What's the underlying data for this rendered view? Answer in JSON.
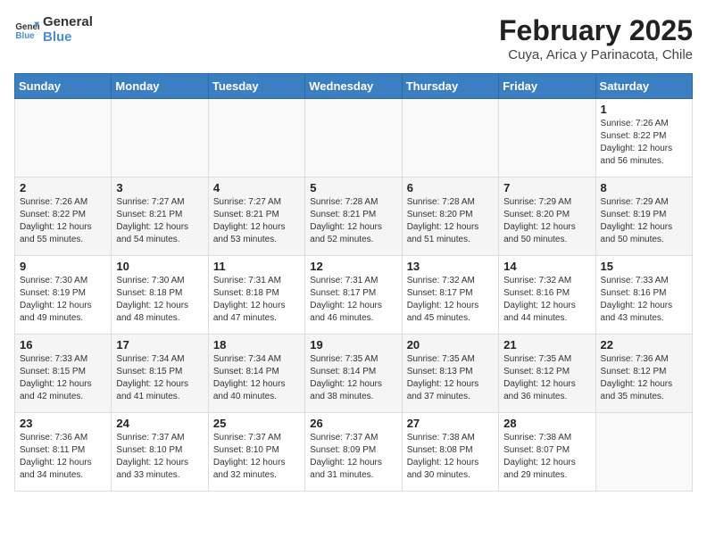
{
  "header": {
    "logo_line1": "General",
    "logo_line2": "Blue",
    "title": "February 2025",
    "subtitle": "Cuya, Arica y Parinacota, Chile"
  },
  "calendar": {
    "days_of_week": [
      "Sunday",
      "Monday",
      "Tuesday",
      "Wednesday",
      "Thursday",
      "Friday",
      "Saturday"
    ],
    "weeks": [
      {
        "shade": false,
        "days": [
          {
            "num": "",
            "info": ""
          },
          {
            "num": "",
            "info": ""
          },
          {
            "num": "",
            "info": ""
          },
          {
            "num": "",
            "info": ""
          },
          {
            "num": "",
            "info": ""
          },
          {
            "num": "",
            "info": ""
          },
          {
            "num": "1",
            "info": "Sunrise: 7:26 AM\nSunset: 8:22 PM\nDaylight: 12 hours and 56 minutes."
          }
        ]
      },
      {
        "shade": true,
        "days": [
          {
            "num": "2",
            "info": "Sunrise: 7:26 AM\nSunset: 8:22 PM\nDaylight: 12 hours and 55 minutes."
          },
          {
            "num": "3",
            "info": "Sunrise: 7:27 AM\nSunset: 8:21 PM\nDaylight: 12 hours and 54 minutes."
          },
          {
            "num": "4",
            "info": "Sunrise: 7:27 AM\nSunset: 8:21 PM\nDaylight: 12 hours and 53 minutes."
          },
          {
            "num": "5",
            "info": "Sunrise: 7:28 AM\nSunset: 8:21 PM\nDaylight: 12 hours and 52 minutes."
          },
          {
            "num": "6",
            "info": "Sunrise: 7:28 AM\nSunset: 8:20 PM\nDaylight: 12 hours and 51 minutes."
          },
          {
            "num": "7",
            "info": "Sunrise: 7:29 AM\nSunset: 8:20 PM\nDaylight: 12 hours and 50 minutes."
          },
          {
            "num": "8",
            "info": "Sunrise: 7:29 AM\nSunset: 8:19 PM\nDaylight: 12 hours and 50 minutes."
          }
        ]
      },
      {
        "shade": false,
        "days": [
          {
            "num": "9",
            "info": "Sunrise: 7:30 AM\nSunset: 8:19 PM\nDaylight: 12 hours and 49 minutes."
          },
          {
            "num": "10",
            "info": "Sunrise: 7:30 AM\nSunset: 8:18 PM\nDaylight: 12 hours and 48 minutes."
          },
          {
            "num": "11",
            "info": "Sunrise: 7:31 AM\nSunset: 8:18 PM\nDaylight: 12 hours and 47 minutes."
          },
          {
            "num": "12",
            "info": "Sunrise: 7:31 AM\nSunset: 8:17 PM\nDaylight: 12 hours and 46 minutes."
          },
          {
            "num": "13",
            "info": "Sunrise: 7:32 AM\nSunset: 8:17 PM\nDaylight: 12 hours and 45 minutes."
          },
          {
            "num": "14",
            "info": "Sunrise: 7:32 AM\nSunset: 8:16 PM\nDaylight: 12 hours and 44 minutes."
          },
          {
            "num": "15",
            "info": "Sunrise: 7:33 AM\nSunset: 8:16 PM\nDaylight: 12 hours and 43 minutes."
          }
        ]
      },
      {
        "shade": true,
        "days": [
          {
            "num": "16",
            "info": "Sunrise: 7:33 AM\nSunset: 8:15 PM\nDaylight: 12 hours and 42 minutes."
          },
          {
            "num": "17",
            "info": "Sunrise: 7:34 AM\nSunset: 8:15 PM\nDaylight: 12 hours and 41 minutes."
          },
          {
            "num": "18",
            "info": "Sunrise: 7:34 AM\nSunset: 8:14 PM\nDaylight: 12 hours and 40 minutes."
          },
          {
            "num": "19",
            "info": "Sunrise: 7:35 AM\nSunset: 8:14 PM\nDaylight: 12 hours and 38 minutes."
          },
          {
            "num": "20",
            "info": "Sunrise: 7:35 AM\nSunset: 8:13 PM\nDaylight: 12 hours and 37 minutes."
          },
          {
            "num": "21",
            "info": "Sunrise: 7:35 AM\nSunset: 8:12 PM\nDaylight: 12 hours and 36 minutes."
          },
          {
            "num": "22",
            "info": "Sunrise: 7:36 AM\nSunset: 8:12 PM\nDaylight: 12 hours and 35 minutes."
          }
        ]
      },
      {
        "shade": false,
        "days": [
          {
            "num": "23",
            "info": "Sunrise: 7:36 AM\nSunset: 8:11 PM\nDaylight: 12 hours and 34 minutes."
          },
          {
            "num": "24",
            "info": "Sunrise: 7:37 AM\nSunset: 8:10 PM\nDaylight: 12 hours and 33 minutes."
          },
          {
            "num": "25",
            "info": "Sunrise: 7:37 AM\nSunset: 8:10 PM\nDaylight: 12 hours and 32 minutes."
          },
          {
            "num": "26",
            "info": "Sunrise: 7:37 AM\nSunset: 8:09 PM\nDaylight: 12 hours and 31 minutes."
          },
          {
            "num": "27",
            "info": "Sunrise: 7:38 AM\nSunset: 8:08 PM\nDaylight: 12 hours and 30 minutes."
          },
          {
            "num": "28",
            "info": "Sunrise: 7:38 AM\nSunset: 8:07 PM\nDaylight: 12 hours and 29 minutes."
          },
          {
            "num": "",
            "info": ""
          }
        ]
      }
    ]
  }
}
